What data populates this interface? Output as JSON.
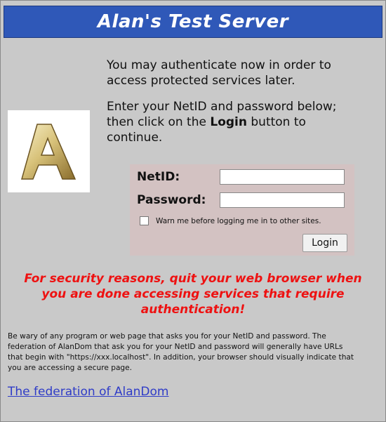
{
  "header": {
    "title": "Alan's Test Server"
  },
  "intro": {
    "line1": "You may authenticate now in order to",
    "line2": "access protected services later.",
    "line3": "Enter your NetID and password below;",
    "line4_pre": "then click on the ",
    "line4_bold": "Login",
    "line4_post": " button to",
    "line5": "continue."
  },
  "form": {
    "netid_label": "NetID:",
    "netid_value": "",
    "password_label": "Password:",
    "password_value": "",
    "warn_label": "Warn me before logging me in to other sites.",
    "warn_checked": false,
    "login_label": "Login"
  },
  "security_warning": {
    "line1": "For security reasons, quit your web browser when",
    "line2": "you are done accessing services that require",
    "line3": "authentication!"
  },
  "notice": {
    "line1": "Be wary of any program or web page that asks you for your NetID and password. The",
    "line2": "federation of AlanDom that ask you for your NetID and password will generally have URLs",
    "line3": "that begin with \"https://xxx.localhost\". In addition, your browser should visually indicate that",
    "line4": "you are accessing a secure page."
  },
  "footer": {
    "link_text": "The federation of AlanDom"
  },
  "colors": {
    "header_bg": "#2f58b8",
    "warning": "#ee1111",
    "link": "#2f3cc7",
    "login_box_bg": "#d3c2c2"
  }
}
